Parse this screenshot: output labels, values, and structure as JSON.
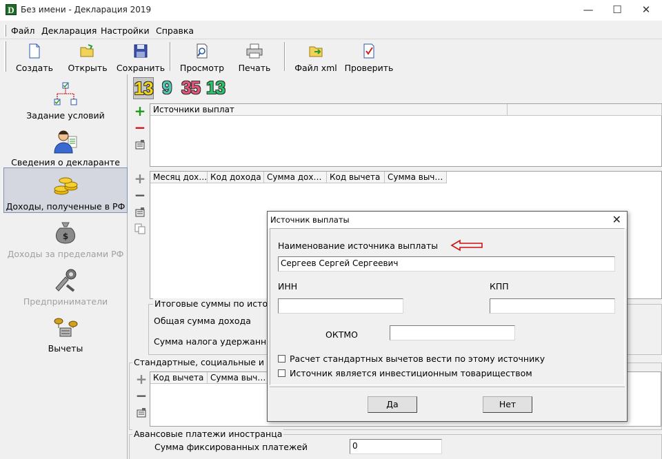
{
  "window": {
    "title": "Без имени - Декларация 2019",
    "app_icon": "D",
    "minimize_glyph": "—",
    "maximize_glyph": "☐",
    "close_glyph": "✕"
  },
  "menu": [
    "Файл",
    "Декларация",
    "Настройки",
    "Справка"
  ],
  "toolbar": {
    "create": "Создать",
    "open": "Открыть",
    "save": "Сохранить",
    "preview": "Просмотр",
    "print": "Печать",
    "xml": "Файл xml",
    "check": "Проверить"
  },
  "sidebar": {
    "items": [
      {
        "label": "Задание условий",
        "icon": "tree-checklist-icon",
        "state": "normal"
      },
      {
        "label": "Сведения о декларанте",
        "icon": "person-icon",
        "state": "normal"
      },
      {
        "label": "Доходы, полученные в РФ",
        "icon": "coins-icon",
        "state": "active"
      },
      {
        "label": "Доходы за пределами РФ",
        "icon": "money-bag-icon",
        "state": "disabled"
      },
      {
        "label": "Предприниматели",
        "icon": "tools-icon",
        "state": "disabled"
      },
      {
        "label": "Вычеты",
        "icon": "scales-icon",
        "state": "normal"
      }
    ]
  },
  "tax_rates": [
    {
      "label": "13",
      "color": "#f2d41c",
      "selected": true
    },
    {
      "label": "9",
      "color": "#4fc9b4",
      "selected": false
    },
    {
      "label": "35",
      "color": "#e8547a",
      "selected": false
    },
    {
      "label": "13",
      "color": "#2ac46a",
      "selected": false
    }
  ],
  "sources_table": {
    "column": "Источники выплат"
  },
  "income_table": {
    "columns": [
      "Месяц дох…",
      "Код дохода",
      "Сумма дох…",
      "Код вычета",
      "Сумма выч…"
    ]
  },
  "totals": {
    "title": "Итоговые суммы по источ",
    "total_income_label": "Общая сумма дохода",
    "tax_withheld_label": "Сумма налога удержанна"
  },
  "deductions": {
    "title": "Стандартные, социальные и им",
    "columns": [
      "Код вычета",
      "Сумма выч…"
    ]
  },
  "advance": {
    "title": "Авансовые платежи иностранца",
    "fixed_label": "Сумма фиксированных платежей",
    "fixed_value": "0"
  },
  "dialog": {
    "title": "Источник выплаты",
    "name_label": "Наименование источника выплаты",
    "name_value": "Сергеев Сергей Сергеевич",
    "inn_label": "ИНН",
    "inn_value": "",
    "kpp_label": "КПП",
    "kpp_value": "",
    "oktmo_label": "ОКТМО",
    "oktmo_value": "",
    "check_standard": "Расчет стандартных вычетов вести по этому источнику",
    "check_investment": "Источник является инвестиционным товариществом",
    "ok": "Да",
    "cancel": "Нет",
    "arrow_color": "#cc1111"
  }
}
